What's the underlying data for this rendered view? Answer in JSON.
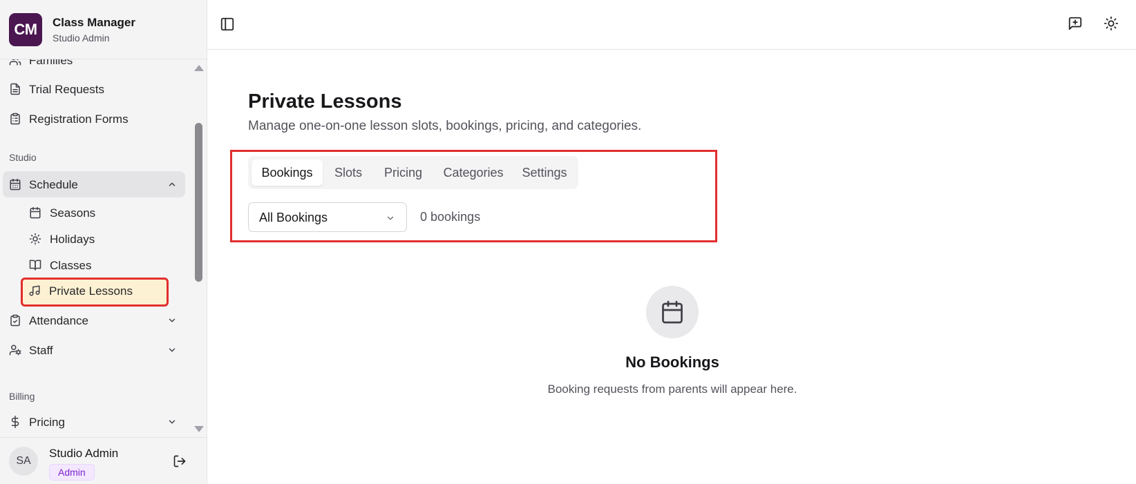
{
  "brand": {
    "logo_text": "CM",
    "title": "Class Manager",
    "subtitle": "Studio Admin",
    "logo_color": "#4a1750"
  },
  "sidebar": {
    "items_top": [
      {
        "label": "Families",
        "icon": "users-icon"
      },
      {
        "label": "Trial Requests",
        "icon": "file-text-icon"
      },
      {
        "label": "Registration Forms",
        "icon": "clipboard-list-icon"
      }
    ],
    "section_studio": "Studio",
    "schedule": {
      "label": "Schedule",
      "icon": "calendar-icon",
      "children": [
        {
          "label": "Seasons",
          "icon": "calendar-icon"
        },
        {
          "label": "Holidays",
          "icon": "sun-icon"
        },
        {
          "label": "Classes",
          "icon": "book-open-icon"
        },
        {
          "label": "Private Lessons",
          "icon": "music-icon"
        }
      ]
    },
    "attendance": {
      "label": "Attendance",
      "icon": "clipboard-check-icon"
    },
    "staff": {
      "label": "Staff",
      "icon": "user-cog-icon"
    },
    "section_billing": "Billing",
    "pricing": {
      "label": "Pricing",
      "icon": "dollar-sign-icon"
    }
  },
  "user": {
    "initials": "SA",
    "name": "Studio Admin",
    "role": "Admin"
  },
  "header": {
    "toggle_sidebar": "panel-left-icon",
    "feedback": "message-plus-icon",
    "theme": "sun-icon"
  },
  "main": {
    "title": "Private Lessons",
    "subtitle": "Manage one-on-one lesson slots, bookings, pricing, and categories.",
    "tabs": [
      {
        "label": "Bookings",
        "active": true
      },
      {
        "label": "Slots",
        "active": false
      },
      {
        "label": "Pricing",
        "active": false
      },
      {
        "label": "Categories",
        "active": false
      },
      {
        "label": "Settings",
        "active": false
      }
    ],
    "filter": {
      "selected": "All Bookings"
    },
    "count_text": "0 bookings",
    "empty": {
      "title": "No Bookings",
      "message": "Booking requests from parents will appear here."
    }
  },
  "colors": {
    "highlight": "#e32d2d",
    "active_nav_bg": "#fdf1d3",
    "role_badge": "#7e22ce"
  }
}
